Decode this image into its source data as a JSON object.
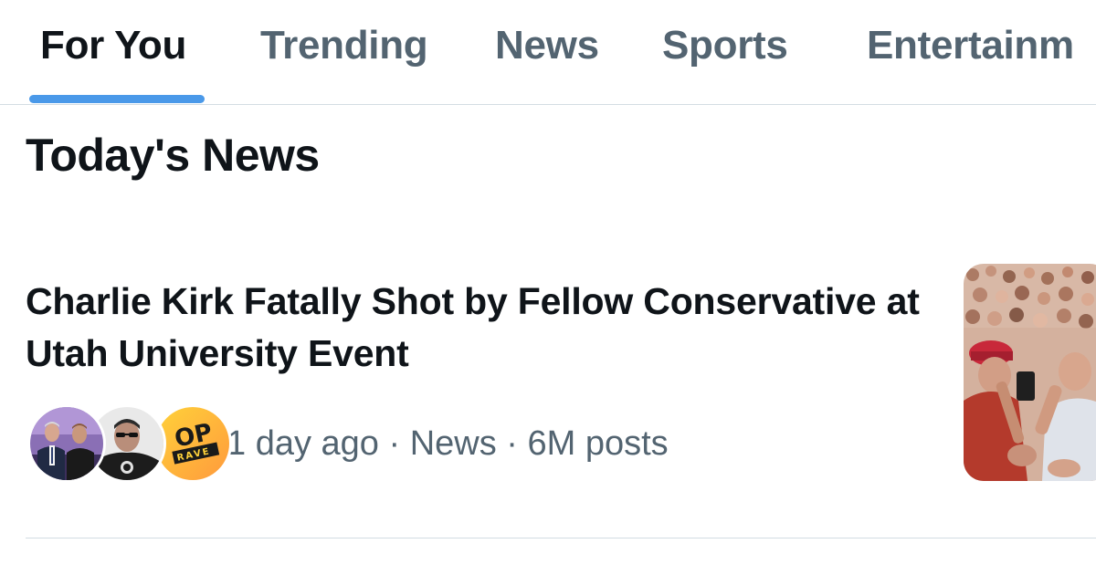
{
  "tabs": [
    {
      "label": "For You",
      "active": true
    },
    {
      "label": "Trending",
      "active": false
    },
    {
      "label": "News",
      "active": false
    },
    {
      "label": "Sports",
      "active": false
    },
    {
      "label": "Entertainm",
      "active": false
    }
  ],
  "section": {
    "title": "Today's News"
  },
  "news_item": {
    "headline": "Charlie Kirk Fatally Shot by Fellow Conservative at Utah University Event",
    "meta": "1 day ago · News · 6M posts",
    "avatars": [
      {
        "icon": "two-men-photo-avatar"
      },
      {
        "icon": "man-portrait-avatar"
      },
      {
        "icon": "pop-crave-logo-avatar",
        "logo_text": "POP CRAVE"
      }
    ],
    "thumbnail_icon": "crowd-photo-thumbnail"
  },
  "colors": {
    "text_primary": "#0f1419",
    "text_secondary": "#536471",
    "accent": "#4a99e9",
    "divider": "#d3dde3"
  }
}
